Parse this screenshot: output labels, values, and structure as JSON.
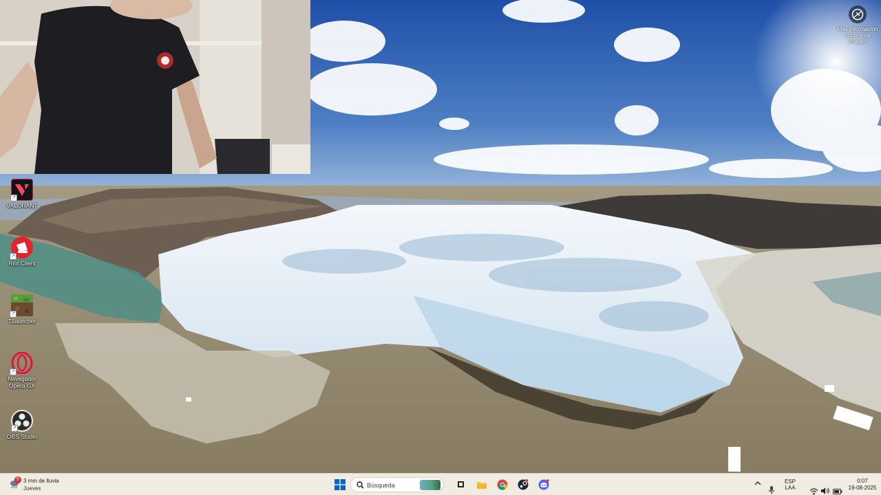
{
  "desktop": {
    "icons": [
      {
        "label": "VALORANT",
        "icon": "valorant-icon",
        "color": "#c4233b"
      },
      {
        "label": "Riot Client",
        "icon": "riot-client-icon",
        "color": "#e0252f"
      },
      {
        "label": "TLauncher",
        "icon": "minecraft-block-icon",
        "color": "#5b8a3a"
      },
      {
        "label": "Navegador Opera GX",
        "icon": "opera-gx-icon",
        "color": "#e2133f"
      },
      {
        "label": "OBS Studio",
        "icon": "obs-icon",
        "color": "#2b2b2b"
      }
    ],
    "info_label": "Más información sobre esta imagen"
  },
  "taskbar": {
    "weather": {
      "badge": "5",
      "line1": "3 mm de lluvia",
      "line2": "Jueves"
    },
    "search_placeholder": "Búsqueda",
    "pinned": [
      "windows-start-icon",
      "task-view-icon",
      "file-explorer-icon",
      "chrome-icon",
      "steam-icon",
      "discord-icon"
    ],
    "tray": {
      "lang_top": "ESP",
      "lang_bottom": "LAA",
      "time": "0:07",
      "date": "19-08-2025"
    }
  },
  "colors": {
    "taskbar_bg": "#f1ece2",
    "accent": "#0a64c8"
  }
}
